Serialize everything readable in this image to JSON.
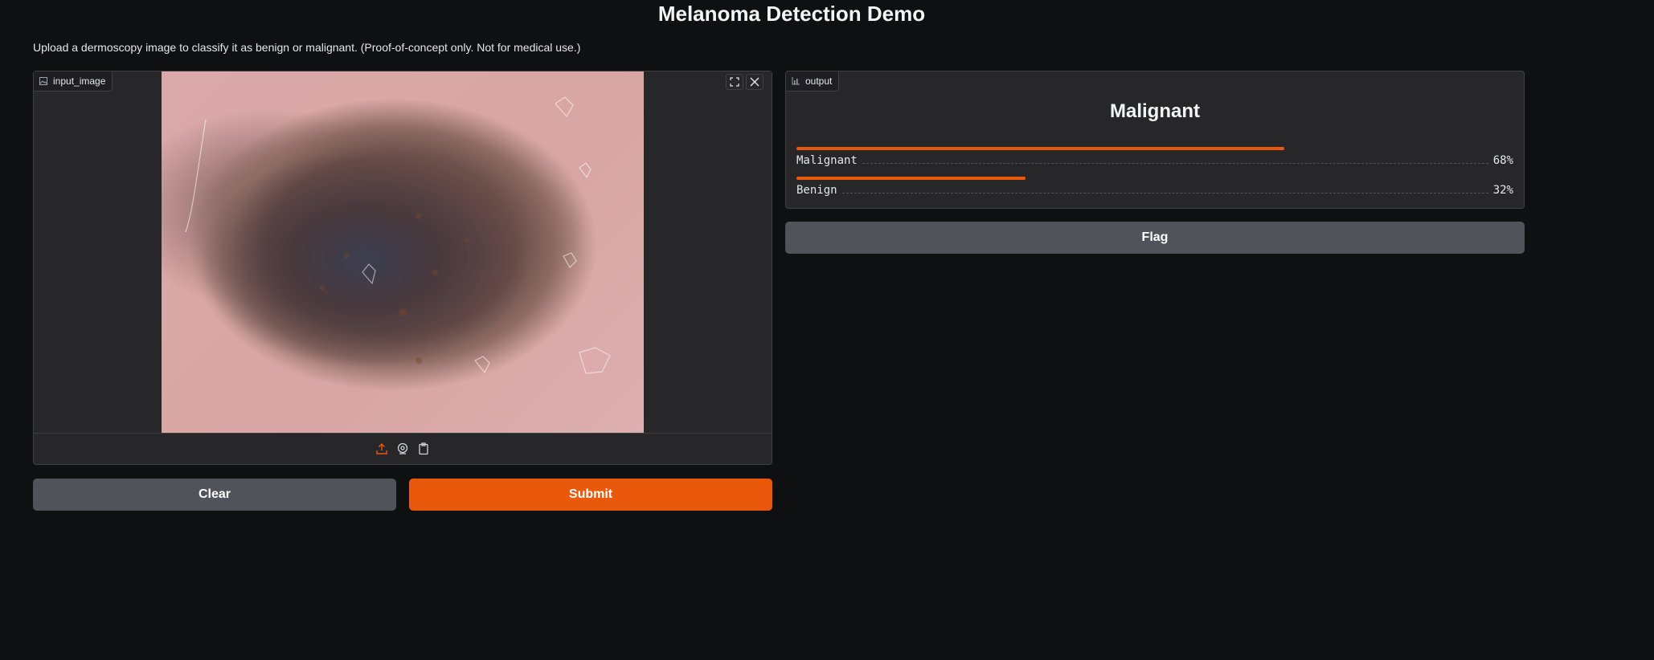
{
  "header": {
    "title": "Melanoma Detection Demo",
    "description": "Upload a dermoscopy image to classify it as benign or malignant. (Proof-of-concept only. Not for medical use.)"
  },
  "input_panel": {
    "label": "input_image",
    "label_icon": "image-icon",
    "actions": [
      "fullscreen-icon",
      "close-icon"
    ],
    "sources": [
      {
        "name": "upload-icon",
        "active": true
      },
      {
        "name": "webcam-icon",
        "active": false
      },
      {
        "name": "clipboard-icon",
        "active": false
      }
    ]
  },
  "buttons": {
    "clear": "Clear",
    "submit": "Submit",
    "flag": "Flag"
  },
  "output_panel": {
    "label": "output",
    "label_icon": "bar-chart-icon",
    "predicted_label": "Malignant",
    "confidences": [
      {
        "label": "Malignant",
        "value": 0.68,
        "display": "68%"
      },
      {
        "label": "Benign",
        "value": 0.32,
        "display": "32%"
      }
    ]
  },
  "colors": {
    "accent": "#ea580c",
    "background": "#0f1012",
    "panel": "#27272a",
    "secondary_button": "#52525b"
  }
}
